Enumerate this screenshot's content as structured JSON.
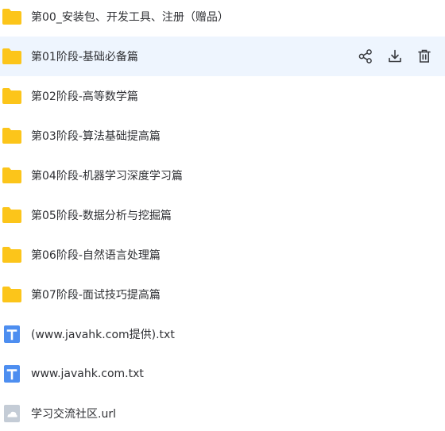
{
  "files": [
    {
      "name": "第00_安装包、开发工具、注册（赠品）",
      "kind": "folder",
      "icon": "folder-icon"
    },
    {
      "name": "第01阶段-基础必备篇",
      "kind": "folder",
      "icon": "folder-icon",
      "hovered": true
    },
    {
      "name": "第02阶段-高等数学篇",
      "kind": "folder",
      "icon": "folder-icon"
    },
    {
      "name": "第03阶段-算法基础提高篇",
      "kind": "folder",
      "icon": "folder-icon"
    },
    {
      "name": "第04阶段-机器学习深度学习篇",
      "kind": "folder",
      "icon": "folder-icon"
    },
    {
      "name": "第05阶段-数据分析与挖掘篇",
      "kind": "folder",
      "icon": "folder-icon"
    },
    {
      "name": "第06阶段-自然语言处理篇",
      "kind": "folder",
      "icon": "folder-icon"
    },
    {
      "name": "第07阶段-面试技巧提高篇",
      "kind": "folder",
      "icon": "folder-icon"
    },
    {
      "name": "(www.javahk.com提供).txt",
      "kind": "txt",
      "icon": "text-file-icon"
    },
    {
      "name": "www.javahk.com.txt",
      "kind": "txt",
      "icon": "text-file-icon"
    },
    {
      "name": "学习交流社区.url",
      "kind": "url",
      "icon": "url-file-icon"
    }
  ],
  "row_actions": [
    {
      "name": "share",
      "icon": "share-icon"
    },
    {
      "name": "download",
      "icon": "download-icon"
    },
    {
      "name": "delete",
      "icon": "trash-icon"
    }
  ],
  "colors": {
    "folder": "#fcc51a",
    "txt": "#4d8ef0",
    "url": "#c4ccd6",
    "hover_bg": "#eef5fe",
    "text": "#2f3034",
    "action_icon": "#3a3c40"
  }
}
